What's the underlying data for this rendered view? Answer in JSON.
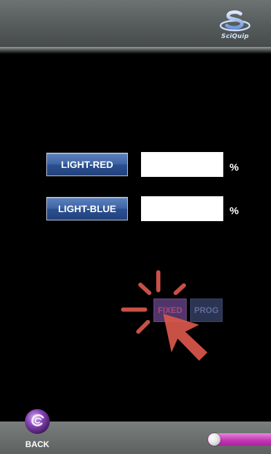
{
  "header": {
    "logo_text": "SciQuip"
  },
  "lights": [
    {
      "label": "LIGHT-RED",
      "value": "",
      "unit": "%"
    },
    {
      "label": "LIGHT-BLUE",
      "value": "",
      "unit": "%"
    }
  ],
  "mode": {
    "fixed_label": "FIXED",
    "prog_label": "PROG",
    "selected": "FIXED"
  },
  "footer": {
    "back_label": "BACK",
    "slider_value": 0
  },
  "colors": {
    "button_blue": "#3e64a5",
    "fixed_active": "#51356a",
    "prog_inactive": "#2c3454",
    "click_indicator": "#d9574b",
    "slider_magenta": "#c438b8"
  },
  "icons": {
    "logo": "sciquip-logo-icon",
    "back": "back-swirl-icon",
    "pointer": "click-pointer-icon"
  }
}
